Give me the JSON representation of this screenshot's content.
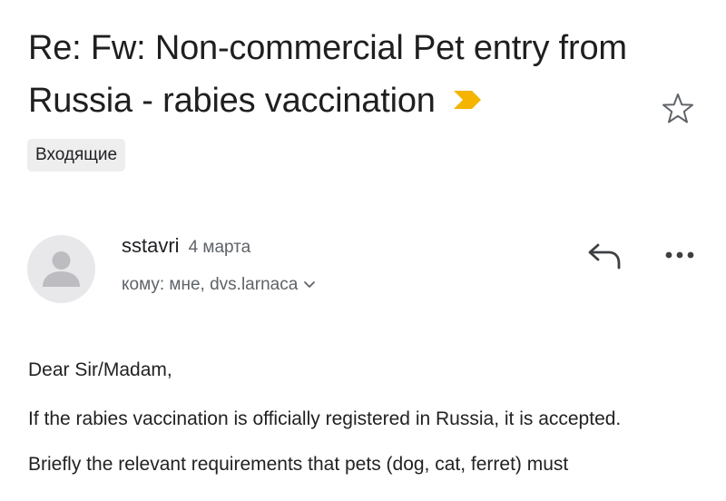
{
  "email": {
    "subject": "Re: Fw: Non-commercial Pet entry from Russia - rabies vaccination",
    "label": "Входящие",
    "sender": {
      "name": "sstavri",
      "date": "4 марта",
      "recipients": "кому: мне, dvs.larnaca"
    },
    "body": {
      "greeting": "Dear Sir/Madam,",
      "paragraph1": "If the rabies vaccination is officially registered in Russia, it is accepted.",
      "paragraph2": "Briefly the relevant requirements that pets (dog, cat, ferret) must"
    }
  },
  "icons": {
    "importance": "importance-marker-icon",
    "star": "star-icon",
    "avatar": "person-avatar-icon",
    "expand": "chevron-down-icon",
    "reply": "reply-icon",
    "more": "more-horizontal-icon"
  },
  "colors": {
    "importance": "#f4b400",
    "icon_gray": "#5f6368",
    "chip_bg": "#eeeeee",
    "avatar_bg": "#e8e8ea"
  }
}
